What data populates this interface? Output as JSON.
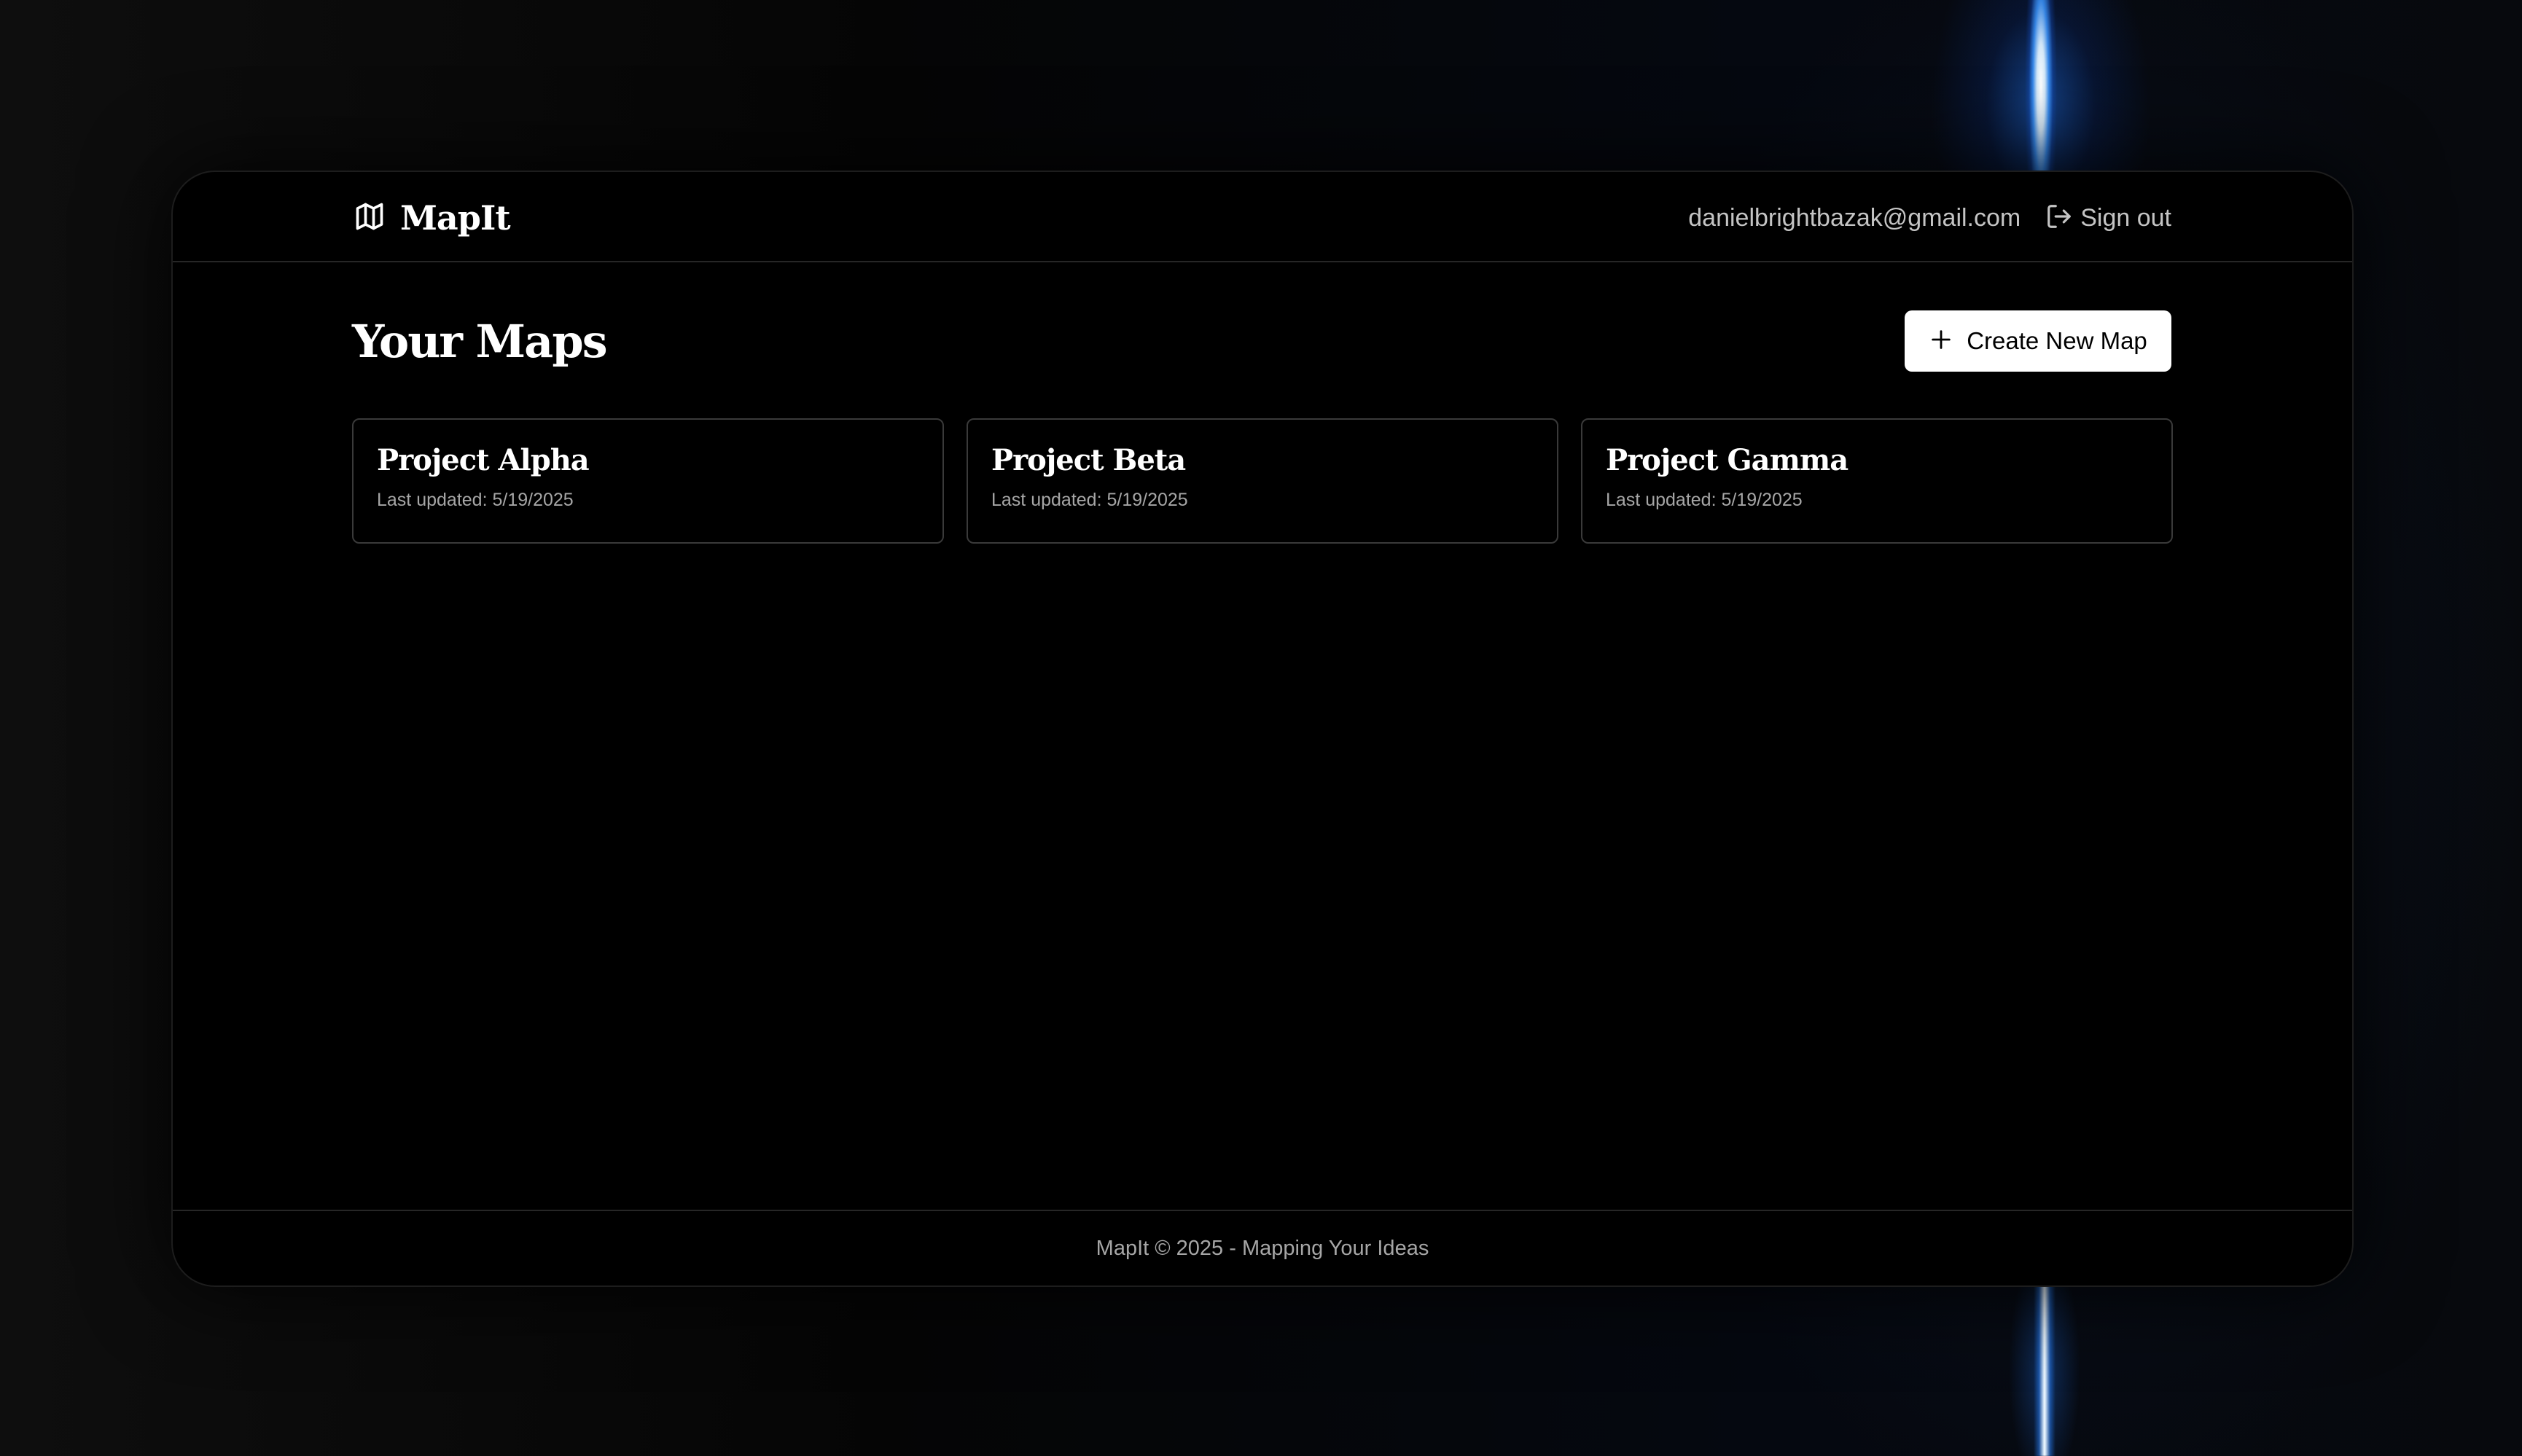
{
  "app": {
    "name": "MapIt"
  },
  "header": {
    "user_email": "danielbrightbazak@gmail.com",
    "sign_out_label": "Sign out"
  },
  "main": {
    "title": "Your Maps",
    "create_button_label": "Create New Map",
    "maps": [
      {
        "title": "Project Alpha",
        "updated_label": "Last updated:",
        "updated_date": "5/19/2025"
      },
      {
        "title": "Project Beta",
        "updated_label": "Last updated:",
        "updated_date": "5/19/2025"
      },
      {
        "title": "Project Gamma",
        "updated_label": "Last updated:",
        "updated_date": "5/19/2025"
      }
    ]
  },
  "footer": {
    "text": "MapIt © 2025 - Mapping Your Ideas"
  },
  "icons": {
    "brand": "map-icon",
    "sign_out": "sign-out-icon",
    "create": "plus-icon"
  },
  "colors": {
    "background": "#000000",
    "accent_beam": "#2f8cff",
    "button_bg": "#ffffff",
    "text_muted": "#c4c4c4"
  }
}
